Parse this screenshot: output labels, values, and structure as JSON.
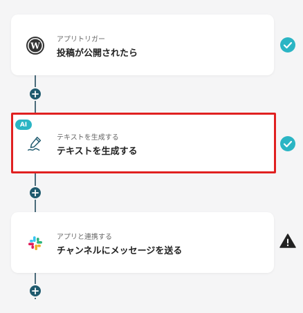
{
  "steps": [
    {
      "category": "アプリトリガー",
      "title": "投稿が公開されたら",
      "icon": "wordpress-icon",
      "status": "complete"
    },
    {
      "category": "テキストを生成する",
      "title": "テキストを生成する",
      "icon": "pen-icon",
      "badge": "AI",
      "status": "complete"
    },
    {
      "category": "アプリと連携する",
      "title": "チャンネルにメッセージを送る",
      "icon": "slack-icon",
      "status": "warning"
    }
  ],
  "add_step_label": "+",
  "colors": {
    "accent": "#2bb5c4",
    "connector": "#1f5a6e",
    "selection": "#e02020",
    "check": "#2bb5c4",
    "warning": "#222222"
  }
}
